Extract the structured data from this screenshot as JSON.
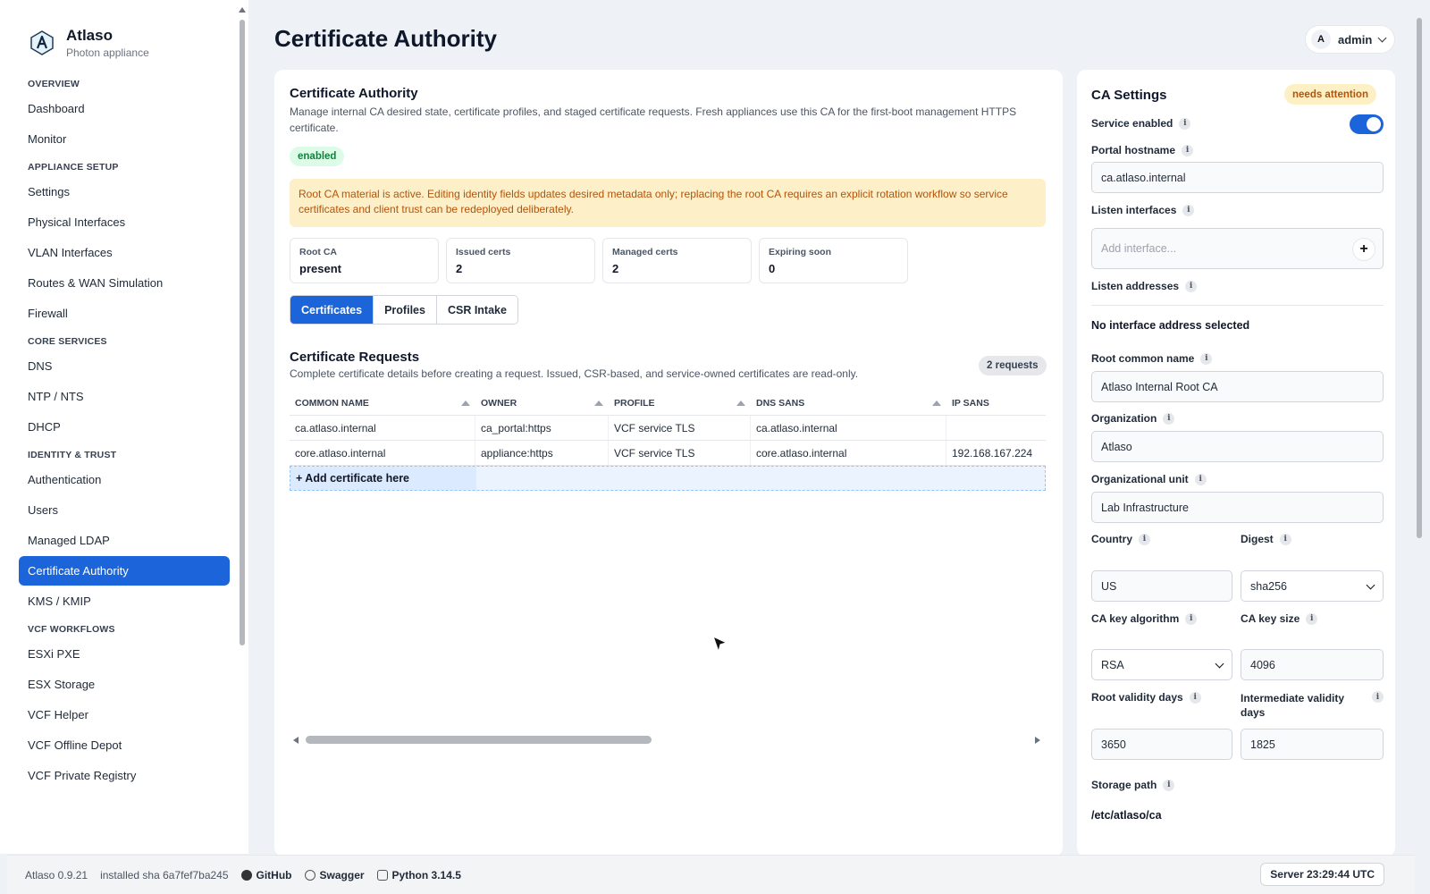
{
  "brand": {
    "title": "Atlaso",
    "subtitle": "Photon appliance"
  },
  "sidebar": {
    "sections": [
      {
        "label": "OVERVIEW",
        "items": [
          "Dashboard",
          "Monitor"
        ]
      },
      {
        "label": "APPLIANCE SETUP",
        "items": [
          "Settings",
          "Physical Interfaces",
          "VLAN Interfaces",
          "Routes & WAN Simulation",
          "Firewall"
        ]
      },
      {
        "label": "CORE SERVICES",
        "items": [
          "DNS",
          "NTP / NTS",
          "DHCP"
        ]
      },
      {
        "label": "IDENTITY & TRUST",
        "items": [
          "Authentication",
          "Users",
          "Managed LDAP",
          "Certificate Authority",
          "KMS / KMIP"
        ]
      },
      {
        "label": "VCF WORKFLOWS",
        "items": [
          "ESXi PXE",
          "ESX Storage",
          "VCF Helper",
          "VCF Offline Depot",
          "VCF Private Registry"
        ]
      }
    ],
    "active_item": "Certificate Authority"
  },
  "header": {
    "title": "Certificate Authority",
    "user_initial": "A",
    "user_name": "admin"
  },
  "main": {
    "title": "Certificate Authority",
    "description": "Manage internal CA desired state, certificate profiles, and staged certificate requests. Fresh appliances use this CA for the first-boot management HTTPS certificate.",
    "status_pill": "enabled",
    "warning": "Root CA material is active. Editing identity fields updates desired metadata only; replacing the root CA requires an explicit rotation workflow so service certificates and client trust can be redeployed deliberately.",
    "stats": [
      {
        "label": "Root CA",
        "value": "present"
      },
      {
        "label": "Issued certs",
        "value": "2"
      },
      {
        "label": "Managed certs",
        "value": "2"
      },
      {
        "label": "Expiring soon",
        "value": "0"
      }
    ],
    "tabs": [
      "Certificates",
      "Profiles",
      "CSR Intake"
    ],
    "active_tab": "Certificates",
    "requests": {
      "title": "Certificate Requests",
      "description": "Complete certificate details before creating a request. Issued, CSR-based, and service-owned certificates are read-only.",
      "badge": "2 requests",
      "columns": [
        "COMMON NAME",
        "OWNER",
        "PROFILE",
        "DNS SANS",
        "IP SANS"
      ],
      "rows": [
        [
          "ca.atlaso.internal",
          "ca_portal:https",
          "VCF service TLS",
          "ca.atlaso.internal",
          ""
        ],
        [
          "core.atlaso.internal",
          "appliance:https",
          "VCF service TLS",
          "core.atlaso.internal",
          "192.168.167.224"
        ]
      ],
      "add_label": "+ Add certificate here"
    }
  },
  "settings": {
    "title": "CA Settings",
    "badge": "needs attention",
    "service_enabled_label": "Service enabled",
    "service_enabled": true,
    "portal_hostname_label": "Portal hostname",
    "portal_hostname": "ca.atlaso.internal",
    "listen_interfaces_label": "Listen interfaces",
    "listen_interfaces_placeholder": "Add interface...",
    "listen_addresses_label": "Listen addresses",
    "listen_addresses_value": "No interface address selected",
    "root_cn_label": "Root common name",
    "root_cn": "Atlaso Internal Root CA",
    "org_label": "Organization",
    "org": "Atlaso",
    "ou_label": "Organizational unit",
    "ou": "Lab Infrastructure",
    "country_label": "Country",
    "country": "US",
    "digest_label": "Digest",
    "digest": "sha256",
    "key_alg_label": "CA key algorithm",
    "key_alg": "RSA",
    "key_size_label": "CA key size",
    "key_size": "4096",
    "root_validity_label": "Root validity days",
    "root_validity": "3650",
    "int_validity_label": "Intermediate validity days",
    "int_validity": "1825",
    "storage_label": "Storage path",
    "storage": "/etc/atlaso/ca"
  },
  "footer": {
    "version": "Atlaso 0.9.21",
    "sha": "installed sha 6a7fef7ba245",
    "github": "GitHub",
    "swagger": "Swagger",
    "python": "Python 3.14.5",
    "server_time": "Server 23:29:44 UTC"
  },
  "colors": {
    "accent": "#1b64da",
    "warning_bg": "#fdefc8",
    "warning_text": "#b45309",
    "success_bg": "#dcfce7"
  }
}
